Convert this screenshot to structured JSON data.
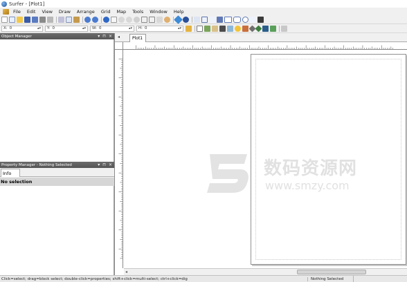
{
  "window": {
    "title": "Surfer - [Plot1]"
  },
  "menu": {
    "items": [
      "File",
      "Edit",
      "View",
      "Draw",
      "Arrange",
      "Grid",
      "Map",
      "Tools",
      "Window",
      "Help"
    ]
  },
  "toolbar_icons": [
    "new-icon",
    "open-icon",
    "save-icon",
    "print-icon",
    "cut-icon",
    "copy-icon",
    "paste-icon",
    "undo-icon",
    "redo-icon",
    "help-icon",
    "select-icon",
    "zoom-in-icon",
    "zoom-out-icon",
    "zoom-fit-icon",
    "pan-icon",
    "map-icon",
    "text-icon",
    "polygon-icon",
    "polyline-icon",
    "symbol-icon",
    "rectangle-icon",
    "rounded-rect-icon",
    "ellipse-icon",
    "spline-icon"
  ],
  "coords": {
    "x": {
      "label": "X:",
      "value": "0"
    },
    "y": {
      "label": "Y:",
      "value": "0"
    },
    "w": {
      "label": "W:",
      "value": "0"
    },
    "h": {
      "label": "H:",
      "value": "0"
    }
  },
  "object_manager": {
    "title": "Object Manager"
  },
  "property_manager": {
    "title": "Property Manager - Nothing Selected",
    "tab": "Info",
    "status": "No selection"
  },
  "document": {
    "tab": "Plot1"
  },
  "watermark": {
    "cn": "数码资源网",
    "url": "www.smzy.com"
  },
  "statusbar": {
    "hint": "Click=select; drag=block select; double-click=properties; shift+click=multi-select; ctrl+click=dig",
    "selection": "Nothing Selected"
  },
  "colors": {
    "accent": "#1d4f9a",
    "pane_title": "#5f5f5f",
    "status_bg": "#d6d6d6"
  }
}
